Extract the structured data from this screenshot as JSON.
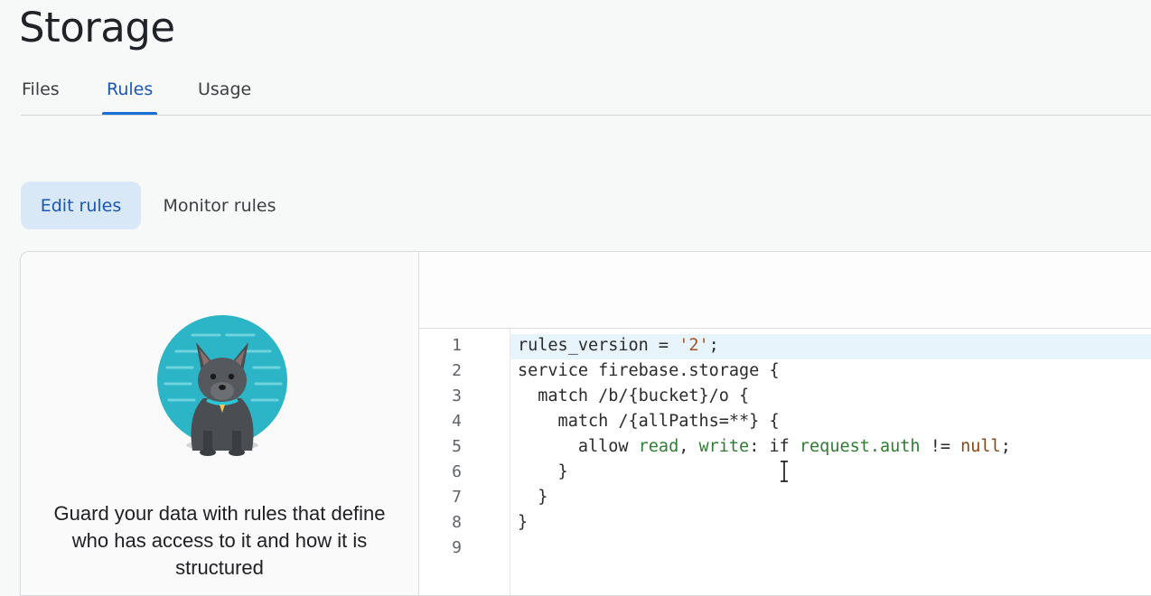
{
  "page": {
    "title": "Storage"
  },
  "tabs": [
    {
      "label": "Files",
      "active": false
    },
    {
      "label": "Rules",
      "active": true
    },
    {
      "label": "Usage",
      "active": false
    }
  ],
  "subtabs": {
    "edit": "Edit rules",
    "monitor": "Monitor rules"
  },
  "left_pane": {
    "illustration": "dog-guard-illustration",
    "text": "Guard your data with rules that define who has access to it and how it is structured"
  },
  "editor": {
    "line_numbers": [
      "1",
      "2",
      "3",
      "4",
      "5",
      "6",
      "7",
      "8",
      "9"
    ],
    "lines": [
      "rules_version = '2';",
      "service firebase.storage {",
      "  match /b/{bucket}/o {",
      "    match /{allPaths=**} {",
      "      allow read, write: if request.auth != null;",
      "    }",
      "  }",
      "}",
      ""
    ]
  },
  "colors": {
    "accent": "#1a6fd6",
    "active_tab_text": "#1a56b8",
    "chip_bg": "#d9e8f7",
    "line_highlight": "#e8f4fb",
    "keyword_green": "#2e7d32",
    "string": "#a0522d"
  }
}
